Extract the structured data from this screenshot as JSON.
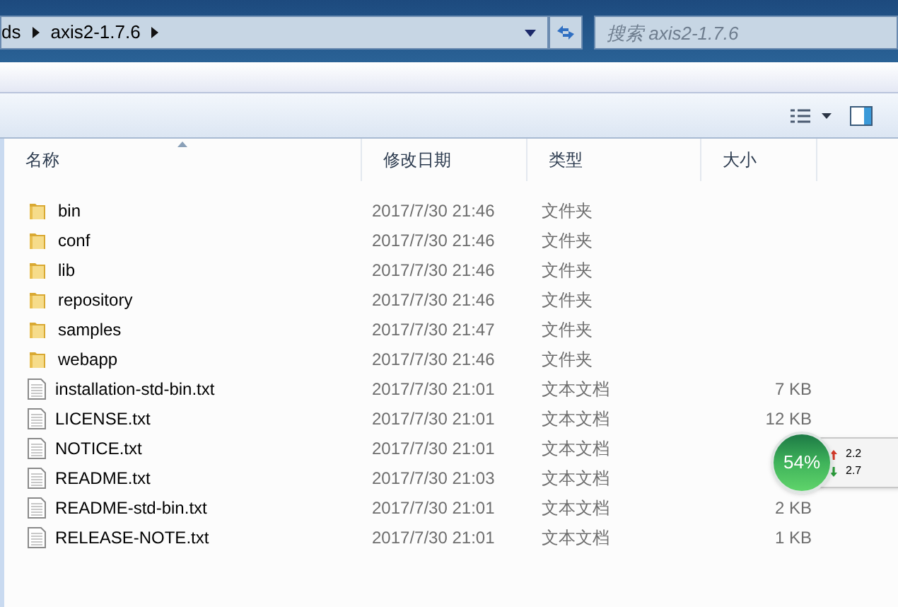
{
  "address_bar": {
    "crumbs": [
      "ds",
      "axis2-1.7.6"
    ]
  },
  "search": {
    "placeholder": "搜索 axis2-1.7.6"
  },
  "table": {
    "columns": [
      {
        "label": "名称",
        "sorted": true
      },
      {
        "label": "修改日期",
        "sorted": false
      },
      {
        "label": "类型",
        "sorted": false
      },
      {
        "label": "大小",
        "sorted": false
      }
    ],
    "rows": [
      {
        "kind": "folder",
        "name": "bin",
        "date": "2017/7/30 21:46",
        "type": "文件夹"
      },
      {
        "kind": "folder",
        "name": "conf",
        "date": "2017/7/30 21:46",
        "type": "文件夹"
      },
      {
        "kind": "folder",
        "name": "lib",
        "date": "2017/7/30 21:46",
        "type": "文件夹"
      },
      {
        "kind": "folder",
        "name": "repository",
        "date": "2017/7/30 21:46",
        "type": "文件夹"
      },
      {
        "kind": "folder",
        "name": "samples",
        "date": "2017/7/30 21:47",
        "type": "文件夹"
      },
      {
        "kind": "folder",
        "name": "webapp",
        "date": "2017/7/30 21:46",
        "type": "文件夹"
      },
      {
        "kind": "file",
        "name": "installation-std-bin.txt",
        "date": "2017/7/30 21:01",
        "type": "文本文档",
        "size": "7 KB"
      },
      {
        "kind": "file",
        "name": "LICENSE.txt",
        "date": "2017/7/30 21:01",
        "type": "文本文档",
        "size": "12 KB"
      },
      {
        "kind": "file",
        "name": "NOTICE.txt",
        "date": "2017/7/30 21:01",
        "type": "文本文档"
      },
      {
        "kind": "file",
        "name": "README.txt",
        "date": "2017/7/30 21:03",
        "type": "文本文档"
      },
      {
        "kind": "file",
        "name": "README-std-bin.txt",
        "date": "2017/7/30 21:01",
        "type": "文本文档",
        "size": "2 KB"
      },
      {
        "kind": "file",
        "name": "RELEASE-NOTE.txt",
        "date": "2017/7/30 21:01",
        "type": "文本文档",
        "size": "1 KB"
      }
    ]
  },
  "speed_widget": {
    "percent": "54%",
    "upload": "2.2",
    "download": "2.7"
  }
}
